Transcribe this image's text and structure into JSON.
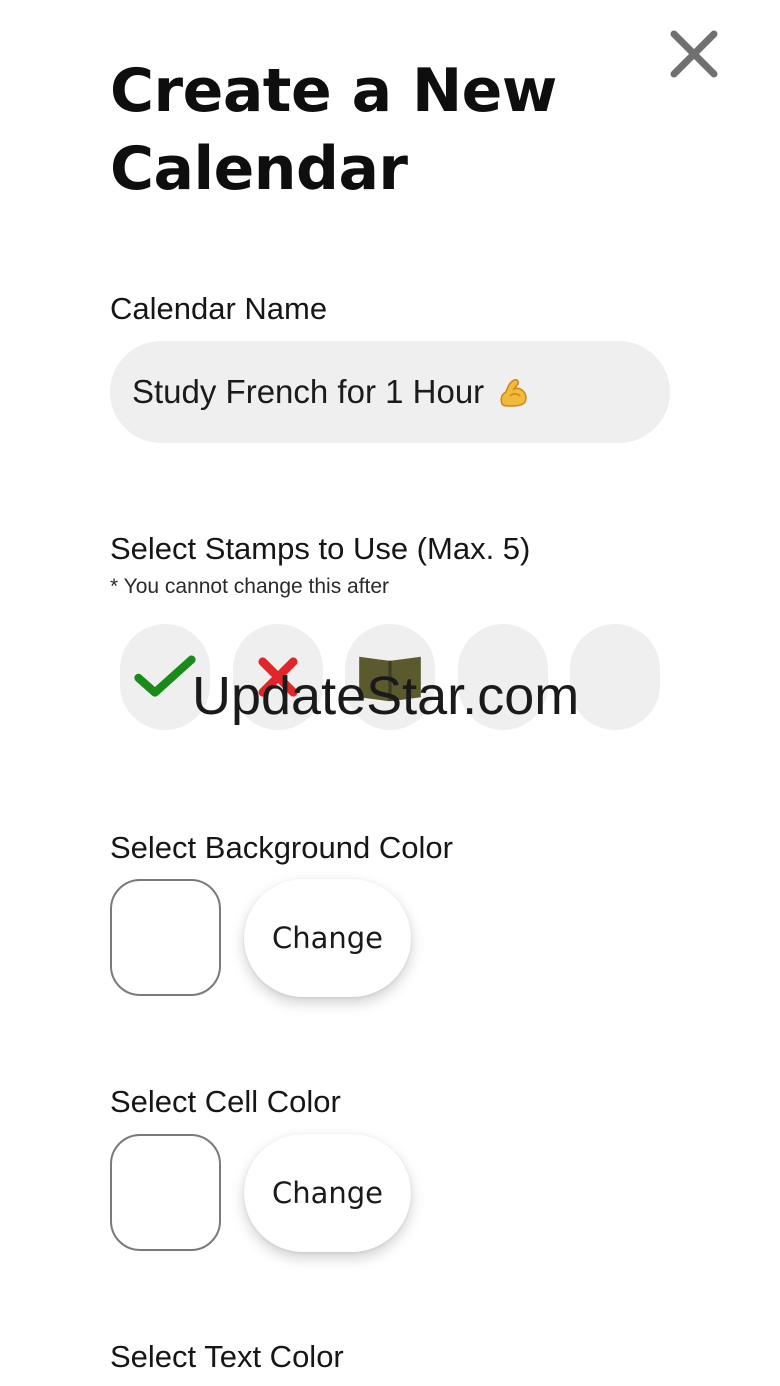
{
  "header": {
    "title": "Create a New Calendar",
    "close_icon": "close-icon"
  },
  "calendar_name": {
    "label": "Calendar Name",
    "value": "Study French for 1 Hour",
    "value_icon": "flexed-biceps-icon"
  },
  "stamps": {
    "label": "Select Stamps to Use (Max. 5)",
    "note": "* You cannot change this after",
    "items": [
      {
        "icon": "check-mark-icon",
        "color": "#1a8a1a"
      },
      {
        "icon": "cross-mark-icon",
        "color": "#e0262b"
      },
      {
        "icon": "open-book-icon",
        "color": "#5b5a2e"
      },
      {
        "icon": "empty-slot"
      },
      {
        "icon": "empty-slot"
      }
    ]
  },
  "background_color": {
    "label": "Select Background Color",
    "button": "Change",
    "value": "#ffffff"
  },
  "cell_color": {
    "label": "Select Cell Color",
    "button": "Change",
    "value": "#ffffff"
  },
  "text_color": {
    "label": "Select Text Color"
  },
  "watermark": "UpdateStar.com"
}
